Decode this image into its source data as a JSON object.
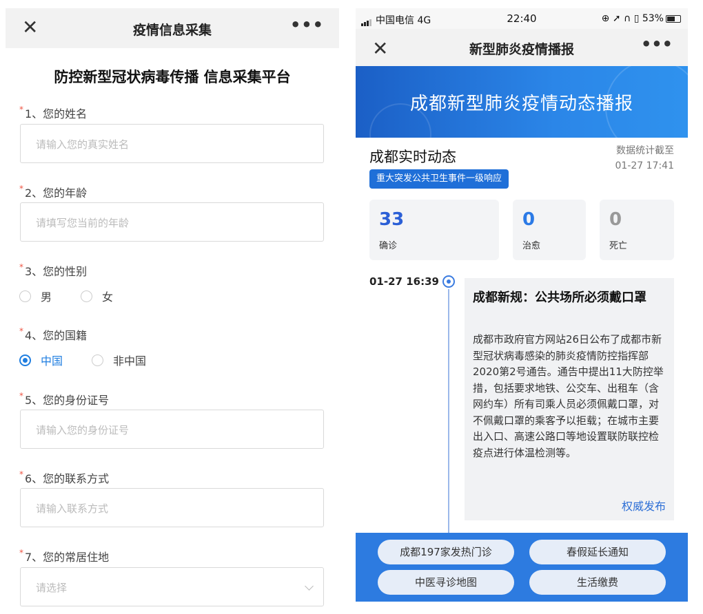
{
  "left": {
    "nav": {
      "close": "✕",
      "title": "疫情信息采集",
      "more": "•••"
    },
    "form_title": "防控新型冠状病毒传播 信息采集平台",
    "required_mark": "*",
    "questions": [
      {
        "label": "1、您的姓名",
        "placeholder": "请输入您的真实姓名"
      },
      {
        "label": "2、您的年龄",
        "placeholder": "请填写您当前的年龄"
      },
      {
        "label": "3、您的性别",
        "options": [
          "男",
          "女"
        ],
        "selected": ""
      },
      {
        "label": "4、您的国籍",
        "options": [
          "中国",
          "非中国"
        ],
        "selected": "中国"
      },
      {
        "label": "5、您的身份证号",
        "placeholder": "请输入您的身份证号"
      },
      {
        "label": "6、您的联系方式",
        "placeholder": "请输入联系方式"
      },
      {
        "label": "7、您的常居住地",
        "placeholder": "请选择"
      }
    ]
  },
  "right": {
    "status": {
      "carrier": "中国电信 4G",
      "time": "22:40",
      "right": "⊕ ➚ ∩ ▯ 53%"
    },
    "nav": {
      "close": "✕",
      "title": "新型肺炎疫情播报",
      "more": "•••"
    },
    "banner": "成都新型肺炎疫情动态播报",
    "realtime_title": "成都实时动态",
    "stamp_line1": "数据统计截至",
    "stamp_line2": "01-27 17:41",
    "badge": "重大突发公共卫生事件一级响应",
    "stats": [
      {
        "num": "33",
        "label": "确诊",
        "color": "#2b5fd6"
      },
      {
        "num": "0",
        "label": "治愈",
        "color": "#2b7ae6"
      },
      {
        "num": "0",
        "label": "死亡",
        "color": "#999999"
      }
    ],
    "timeline": {
      "time": "01-27 16:39",
      "headline": "成都新规：公共场所必须戴口罩",
      "body": "成都市政府官方网站26日公布了成都市新型冠状病毒感染的肺炎疫情防控指挥部2020第2号通告。通告中提出11大防控举措，包括要求地铁、公交车、出租车（含网约车）所有司乘人员必须佩戴口罩，对不佩戴口罩的乘客予以拒载；在城市主要出入口、高速公路口等地设置联防联控检疫点进行体温检测等。",
      "source": "权威发布"
    },
    "buttons": [
      "成都197家发热门诊",
      "春假延长通知",
      "中医寻诊地图",
      "生活缴费"
    ]
  }
}
